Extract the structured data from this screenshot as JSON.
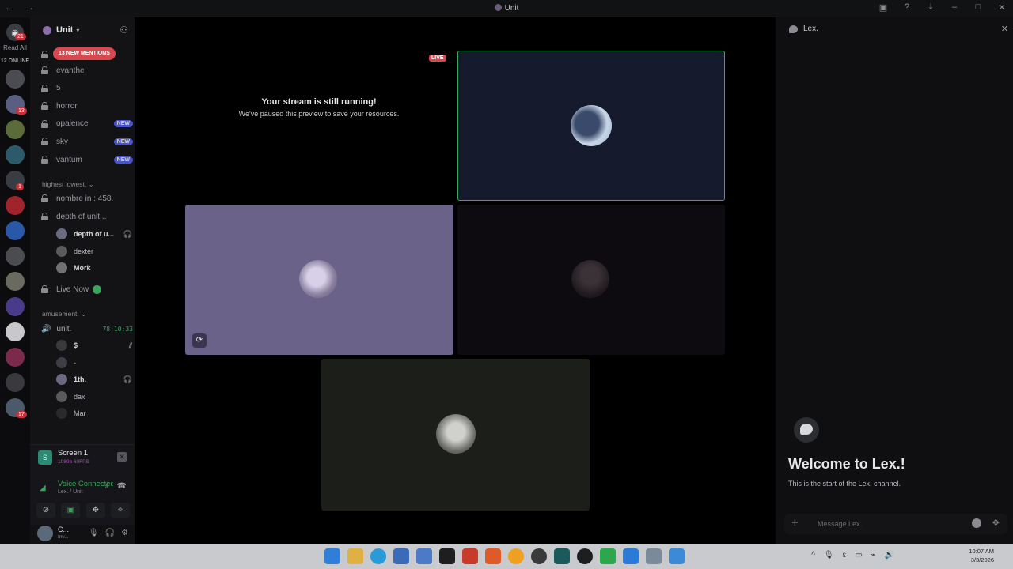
{
  "window": {
    "title": "Unit",
    "nav": "← →"
  },
  "rail": {
    "home_badge": "21",
    "read_all": "Read All",
    "online_count": "12 ONLINE",
    "servers": [
      {
        "color": "#4a4c52",
        "badge": ""
      },
      {
        "color": "#5a5f82",
        "badge": "13"
      },
      {
        "color": "#5b6b3a",
        "badge": ""
      },
      {
        "color": "#2c5a6a",
        "badge": ""
      },
      {
        "color": "#3a3c44",
        "badge": "1"
      },
      {
        "color": "#a0242c",
        "badge": ""
      },
      {
        "color": "#2a58a8",
        "badge": ""
      },
      {
        "color": "#4a4c50",
        "badge": ""
      },
      {
        "color": "#6a6a60",
        "badge": ""
      },
      {
        "color": "#4a3a8a",
        "badge": ""
      },
      {
        "color": "#c8c8cc",
        "badge": ""
      },
      {
        "color": "#7a2a4a",
        "badge": ""
      },
      {
        "color": "#3a3a3e",
        "badge": ""
      },
      {
        "color": "#4a5a6a",
        "badge": "17"
      }
    ]
  },
  "sidebar": {
    "guild_name": "Unit",
    "mentions": "13 NEW MENTIONS",
    "channels": [
      {
        "name": "evanthe",
        "new": ""
      },
      {
        "name": "5",
        "new": ""
      },
      {
        "name": "horror",
        "new": ""
      },
      {
        "name": "opalence",
        "new": "NEW"
      },
      {
        "name": "sky",
        "new": "NEW"
      },
      {
        "name": "vantum",
        "new": "NEW"
      }
    ],
    "category_1": "highest lowest.",
    "channels_2": [
      {
        "name": "nombre in : 458."
      },
      {
        "name": "depth of unit .."
      }
    ],
    "depth_users": [
      {
        "name": "depth of u...",
        "bold": true,
        "color": "#6a6a80"
      },
      {
        "name": "dexter",
        "bold": false,
        "color": "#5a5a58"
      },
      {
        "name": "Mork",
        "bold": true,
        "color": "#707070"
      }
    ],
    "live_now": "Live Now",
    "category_2": "amusement.",
    "voice_channel": "unit.",
    "voice_time": "78:10:33",
    "voice_users": [
      {
        "name": "$",
        "bold": true,
        "color": "#3a3a3c"
      },
      {
        "name": "-",
        "bold": false,
        "color": "#3e3f44"
      },
      {
        "name": "1th.",
        "bold": true,
        "color": "#6a6a80"
      },
      {
        "name": "dax",
        "bold": false,
        "color": "#5a5a5a"
      },
      {
        "name": "Mar",
        "bold": false,
        "color": "#2a2a2a"
      }
    ]
  },
  "screen_share": {
    "title": "Screen 1",
    "quality": "1080p 60FPS"
  },
  "voice": {
    "status": "Voice Connected",
    "location": "Lex. / Unit"
  },
  "user": {
    "name": "C...",
    "status": "Inv..."
  },
  "stage": {
    "paused_title": "Your stream is still running!",
    "paused_subtitle": "We've paused this preview to save your resources.",
    "live_badge": "LIVE"
  },
  "chat": {
    "channel": "Lex.",
    "welcome": "Welcome to Lex.!",
    "start": "This is the start of the Lex. channel.",
    "placeholder": "Message Lex."
  },
  "taskbar": {
    "time": "10:07 AM",
    "date": "3/3/2026"
  }
}
